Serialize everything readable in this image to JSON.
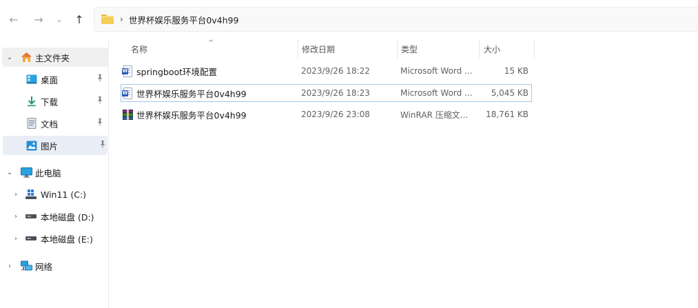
{
  "nav": {
    "back_glyph": "←",
    "forward_glyph": "→",
    "recent_glyph": "⌄",
    "up_glyph": "↑"
  },
  "address": {
    "separator": "›",
    "crumb": "世界杯娱乐服务平台0v4h99"
  },
  "sidebar": {
    "home": {
      "label": "主文件夹",
      "chevron": "⌄",
      "icon": "home-icon"
    },
    "quick": [
      {
        "label": "桌面",
        "icon": "desktop-icon",
        "pin": "📌"
      },
      {
        "label": "下载",
        "icon": "download-icon",
        "pin": "📌"
      },
      {
        "label": "文档",
        "icon": "documents-icon",
        "pin": "📌"
      },
      {
        "label": "图片",
        "icon": "pictures-icon",
        "pin": "📌"
      }
    ],
    "this_pc": {
      "label": "此电脑",
      "chevron": "⌄",
      "icon": "monitor-icon"
    },
    "drives": [
      {
        "label": "Win11 (C:)",
        "chevron": "›",
        "icon": "os-drive-icon"
      },
      {
        "label": "本地磁盘 (D:)",
        "chevron": "›",
        "icon": "drive-icon"
      },
      {
        "label": "本地磁盘 (E:)",
        "chevron": "›",
        "icon": "drive-icon"
      }
    ],
    "network": {
      "label": "网络",
      "chevron": "›",
      "icon": "network-icon"
    }
  },
  "columns": {
    "name": "名称",
    "modified": "修改日期",
    "type": "类型",
    "size": "大小",
    "sort_glyph": "^"
  },
  "files": [
    {
      "name": "springboot环境配置",
      "modified": "2023/9/26 18:22",
      "type": "Microsoft Word ...",
      "size": "15 KB",
      "icon": "word-icon",
      "selected": false
    },
    {
      "name": "世界杯娱乐服务平台0v4h99",
      "modified": "2023/9/26 18:23",
      "type": "Microsoft Word ...",
      "size": "5,045 KB",
      "icon": "word-icon",
      "selected": true
    },
    {
      "name": "世界杯娱乐服务平台0v4h99",
      "modified": "2023/9/26 23:08",
      "type": "WinRAR 压缩文...",
      "size": "18,761 KB",
      "icon": "winrar-icon",
      "selected": false
    }
  ],
  "colors": {
    "selection_border": "#9fc7ea",
    "hover_bg": "#f0f0f0",
    "active_nav_bg": "#e9eef6"
  }
}
